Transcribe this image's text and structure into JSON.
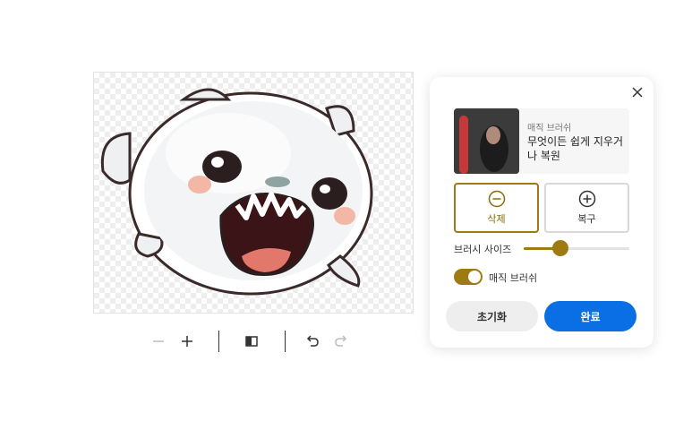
{
  "canvas": {
    "image": "white-fluffy-monster-sticker"
  },
  "toolbar": {
    "zoom_out_icon": "minus-icon",
    "zoom_in_icon": "plus-icon",
    "compare_icon": "split-compare-icon",
    "undo_icon": "undo-icon",
    "redo_icon": "redo-icon"
  },
  "panel": {
    "info_title": "매직 브러쉬",
    "info_desc": "무엇이든 쉽게 지우거나 복원",
    "erase_label": "삭제",
    "restore_label": "복구",
    "brush_size_label": "브러시 사이즈",
    "brush_size_fraction": 0.35,
    "magic_brush_label": "매직 브러쉬",
    "magic_brush_on": true,
    "reset_label": "초기화",
    "done_label": "완료",
    "accent_color": "#9e7a12",
    "primary_color": "#0a6fe4"
  }
}
